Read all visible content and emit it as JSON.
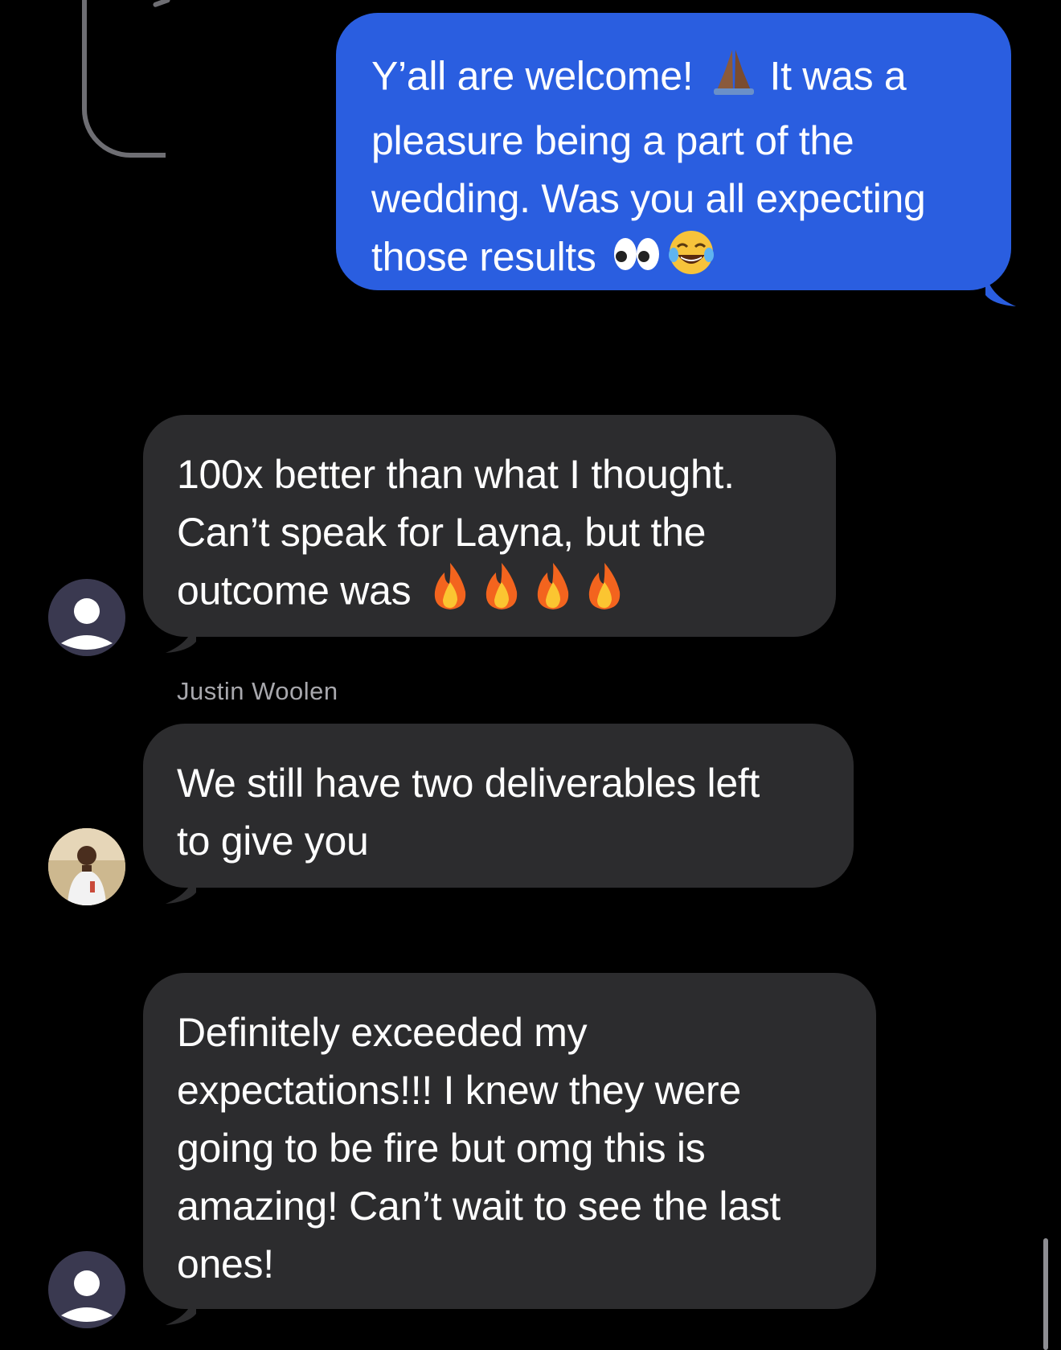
{
  "thread": {
    "messages": [
      {
        "direction": "outgoing",
        "text_before": "Y’all are welcome! ",
        "text_after": " It was a\npleasure being a part of the\nwedding. Was you all expecting\nthose results ",
        "emoji": [
          "folded-hands",
          "eyes",
          "tears-of-joy"
        ]
      },
      {
        "direction": "incoming",
        "text": "100x better than what I thought.\nCan’t speak for Layna, but the\noutcome was ",
        "emoji": [
          "fire",
          "fire",
          "fire",
          "fire"
        ],
        "avatar": "generic"
      },
      {
        "direction": "incoming",
        "sender": "Justin Woolen",
        "text": "We still have two deliverables left\nto give you",
        "avatar": "photo"
      },
      {
        "direction": "incoming",
        "text": "Definitely exceeded my\nexpectations!!! I knew they were\ngoing to be fire but omg this is\namazing! Can’t wait to see the last\nones!",
        "avatar": "generic"
      }
    ]
  },
  "colors": {
    "background": "#000000",
    "outgoing_bubble": "#2a5ee0",
    "incoming_bubble": "#2c2c2e",
    "sender_name": "#a8a8ad"
  }
}
